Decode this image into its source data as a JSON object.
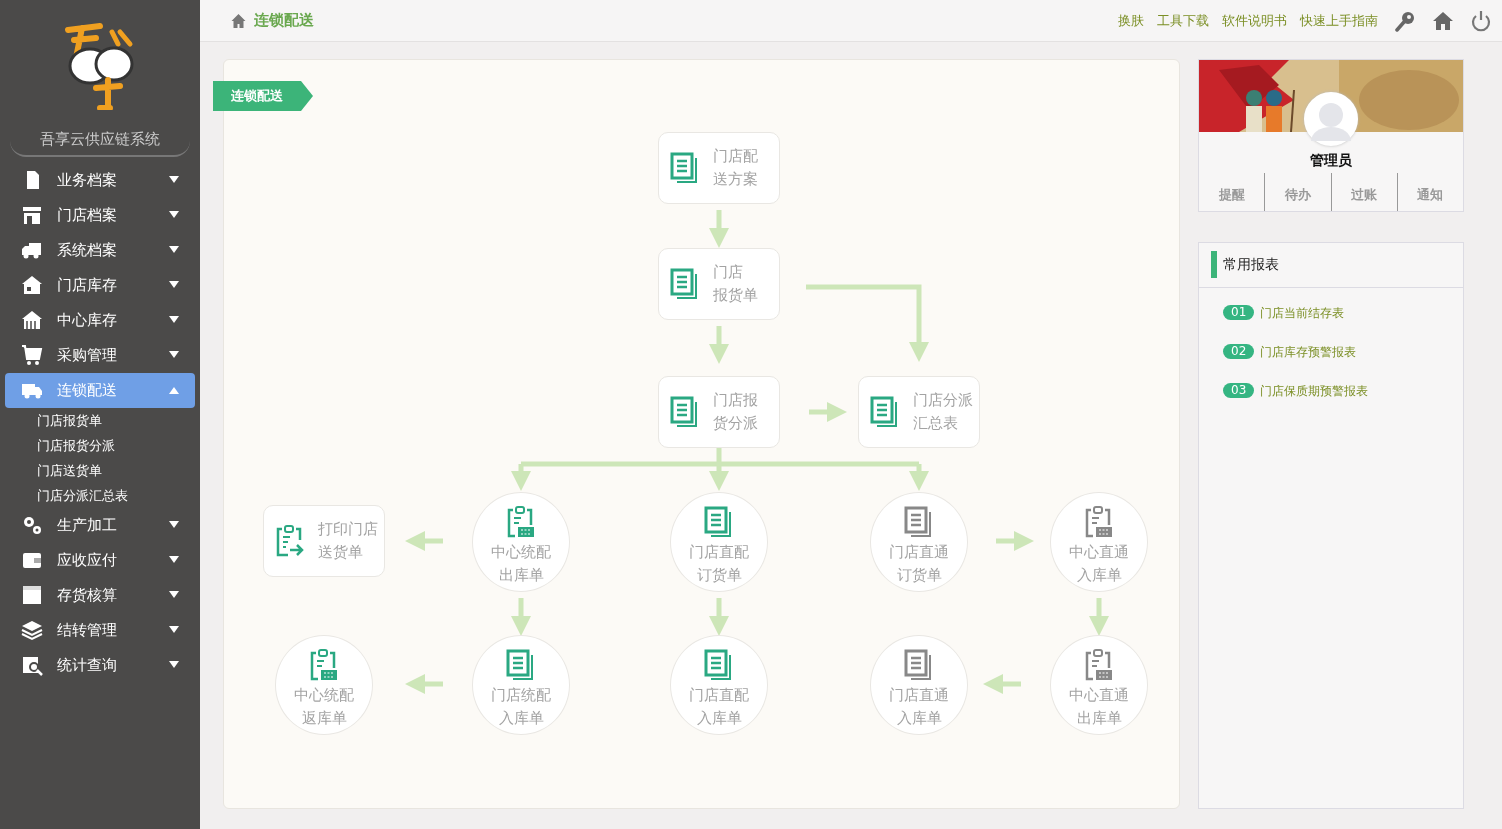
{
  "sidebar": {
    "system_name": "吾享云供应链系统",
    "items": [
      {
        "label": "业务档案",
        "expanded": false,
        "selected": false
      },
      {
        "label": "门店档案",
        "expanded": false,
        "selected": false
      },
      {
        "label": "系统档案",
        "expanded": false,
        "selected": false
      },
      {
        "label": "门店库存",
        "expanded": false,
        "selected": false
      },
      {
        "label": "中心库存",
        "expanded": false,
        "selected": false
      },
      {
        "label": "采购管理",
        "expanded": false,
        "selected": false
      },
      {
        "label": "连锁配送",
        "expanded": true,
        "selected": true,
        "children": [
          {
            "label": "门店报货单"
          },
          {
            "label": "门店报货分派"
          },
          {
            "label": "门店送货单"
          },
          {
            "label": "门店分派汇总表"
          }
        ]
      },
      {
        "label": "生产加工",
        "expanded": false,
        "selected": false
      },
      {
        "label": "应收应付",
        "expanded": false,
        "selected": false
      },
      {
        "label": "存货核算",
        "expanded": false,
        "selected": false
      },
      {
        "label": "结转管理",
        "expanded": false,
        "selected": false
      },
      {
        "label": "统计查询",
        "expanded": false,
        "selected": false
      }
    ]
  },
  "header": {
    "breadcrumb": "连锁配送",
    "links": [
      "换肤",
      "工具下载",
      "软件说明书",
      "快速上手指南"
    ]
  },
  "flow": {
    "tag": "连锁配送",
    "nodes": [
      {
        "kind": "box",
        "color": "#2aa882",
        "lines": [
          "门店配",
          "送方案"
        ]
      },
      {
        "kind": "box",
        "color": "#2aa882",
        "lines": [
          "门店",
          "报货单"
        ]
      },
      {
        "kind": "box",
        "color": "#2aa882",
        "lines": [
          "门店报",
          "货分派"
        ]
      },
      {
        "kind": "box",
        "color": "#2aa882",
        "lines": [
          "门店分派",
          "汇总表"
        ]
      },
      {
        "kind": "box",
        "color": "#2aa882",
        "lines": [
          "打印门店",
          "送货单"
        ]
      },
      {
        "kind": "circle",
        "color": "#2aa882",
        "lines": [
          "中心统配",
          "出库单"
        ]
      },
      {
        "kind": "circle",
        "color": "#2aa882",
        "lines": [
          "门店直配",
          "订货单"
        ]
      },
      {
        "kind": "circle",
        "color": "#888888",
        "lines": [
          "门店直通",
          "订货单"
        ]
      },
      {
        "kind": "circle",
        "color": "#888888",
        "lines": [
          "中心直通",
          "入库单"
        ]
      },
      {
        "kind": "circle",
        "color": "#2aa882",
        "lines": [
          "中心统配",
          "返库单"
        ]
      },
      {
        "kind": "circle",
        "color": "#2aa882",
        "lines": [
          "门店统配",
          "入库单"
        ]
      },
      {
        "kind": "circle",
        "color": "#2aa882",
        "lines": [
          "门店直配",
          "入库单"
        ]
      },
      {
        "kind": "circle",
        "color": "#888888",
        "lines": [
          "门店直通",
          "入库单"
        ]
      },
      {
        "kind": "circle",
        "color": "#888888",
        "lines": [
          "中心直通",
          "出库单"
        ]
      }
    ]
  },
  "profile": {
    "name": "管理员",
    "tabs": [
      "提醒",
      "待办",
      "过账",
      "通知"
    ]
  },
  "reports": {
    "title": "常用报表",
    "items": [
      {
        "number": "01",
        "label": "门店当前结存表"
      },
      {
        "number": "02",
        "label": "门店库存预警报表"
      },
      {
        "number": "03",
        "label": "门店保质期预警报表"
      }
    ]
  }
}
